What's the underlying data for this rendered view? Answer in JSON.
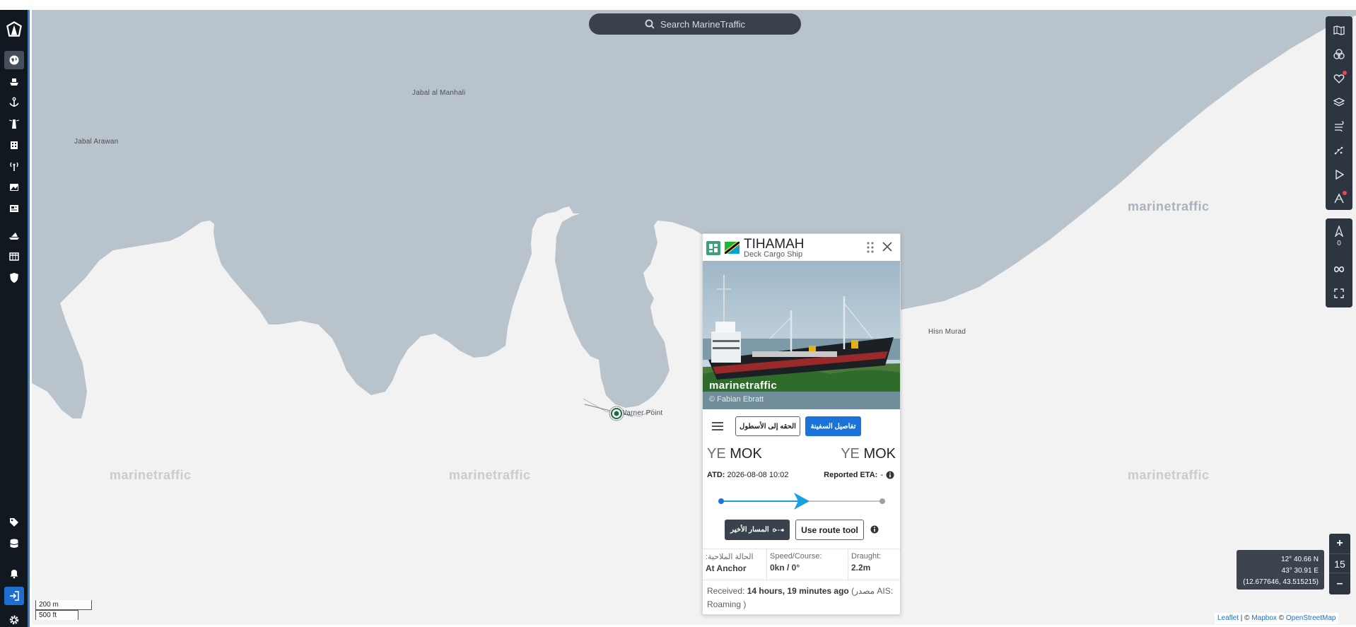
{
  "search": {
    "placeholder": "Search MarineTraffic"
  },
  "map": {
    "places": [
      "Jabal al Manhali",
      "Jabal Arawan",
      "Hisn Murad",
      "Warner Point"
    ],
    "watermark": "marinetraffic",
    "colors": {
      "land": "#f2f2f2",
      "water": "#b9c3cb"
    }
  },
  "nav": {
    "icons": [
      "marinetraffic-logo-icon",
      "globe-icon",
      "ship-icon",
      "anchor-icon",
      "lighthouse-icon",
      "building-icon",
      "antenna-icon",
      "photos-icon",
      "news-icon",
      "fleet-icon",
      "table-icon",
      "shield-icon",
      "tag-icon",
      "database-icon",
      "bell-icon",
      "login-icon",
      "settings-icon"
    ]
  },
  "right_tools": {
    "icons": [
      "map-icon",
      "filters-icon",
      "favorites-icon",
      "layers-icon",
      "weather-icon",
      "density-icon",
      "play-icon",
      "measure-icon"
    ],
    "vessel_count": "0"
  },
  "zoom": {
    "in_label": "+",
    "out_label": "–",
    "level": "15"
  },
  "coords": {
    "lat": "12° 40.66 N",
    "lon": "43° 30.91 E",
    "decimal": "(12.677646, 43.515215)"
  },
  "scale": {
    "metric": "200 m",
    "imperial": "500 ft"
  },
  "attribution": {
    "leaflet": "Leaflet",
    "sep": " | © ",
    "mapbox": "Mapbox",
    "osm_prefix": " © ",
    "osm": "OpenStreetMap"
  },
  "popup": {
    "ship_name": "TIHAMAH",
    "ship_type": "Deck Cargo Ship",
    "photo_brand": "marinetraffic",
    "photo_credit": "© Fabian Ebratt",
    "add_to_fleet": "الحقه إلى الأسطول",
    "vessel_details": "تفاصيل السفينة",
    "departure": {
      "country": "YE",
      "port": "MOK"
    },
    "arrival": {
      "country": "YE",
      "port": "MOK"
    },
    "atd_label": "ATD:",
    "atd_value": "2026-08-08 10:02",
    "eta_label": "Reported ETA:",
    "eta_value": "-",
    "progress": 0.5,
    "last_route": "المسار الأخير",
    "route_tool": "Use route tool",
    "status": {
      "nav_label": "الحالة الملاحية:",
      "nav_value": "At Anchor",
      "speed_label": "Speed/Course:",
      "speed_value": "0kn / 0°",
      "draught_label": "Draught:",
      "draught_value": "2.2m"
    },
    "received_label": "Received:",
    "received_value": "14 hours, 19 minutes ago",
    "received_source": "(مصدر AIS: Roaming )",
    "accent": "#1a73d9"
  }
}
